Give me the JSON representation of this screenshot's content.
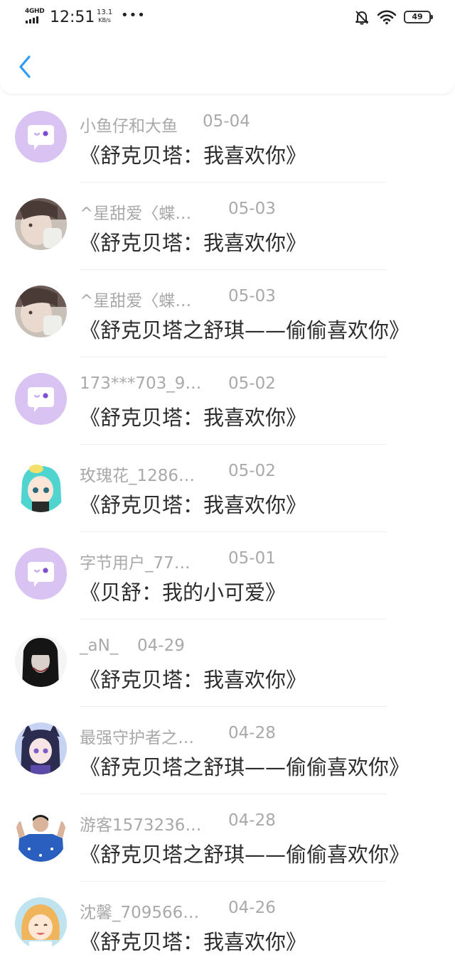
{
  "status_bar": {
    "network": "4GHD",
    "time": "12:51",
    "speed_value": "13.1",
    "speed_unit": "KB/s",
    "more": "•••",
    "battery": "49",
    "icons": [
      "signal-icon",
      "mute-bell-icon",
      "wifi-icon",
      "battery-icon"
    ]
  },
  "nav": {
    "back_icon": "chevron-left-icon",
    "accent_color": "#2f9cf4"
  },
  "comments": [
    {
      "name": "小鱼仔和大鱼",
      "date": "05-04",
      "text": "《舒克贝塔：我喜欢你》",
      "avatar": "default"
    },
    {
      "name": "^星甜爱〈蝶…",
      "date": "05-03",
      "text": "《舒克贝塔：我喜欢你》",
      "avatar": "photo-girl"
    },
    {
      "name": "^星甜爱〈蝶…",
      "date": "05-03",
      "text": "《舒克贝塔之舒琪——偷偷喜欢你》",
      "avatar": "photo-girl"
    },
    {
      "name": "173***703_9…",
      "date": "05-02",
      "text": "《舒克贝塔：我喜欢你》",
      "avatar": "default"
    },
    {
      "name": "玫瑰花_1286…",
      "date": "05-02",
      "text": "《舒克贝塔：我喜欢你》",
      "avatar": "anime-teal"
    },
    {
      "name": "字节用户_77…",
      "date": "05-01",
      "text": "《贝舒：我的小可爱》",
      "avatar": "default"
    },
    {
      "name": "_aN_",
      "date": "04-29",
      "text": "《舒克贝塔：我喜欢你》",
      "avatar": "photo-dark"
    },
    {
      "name": "最强守护者之…",
      "date": "04-28",
      "text": "《舒克贝塔之舒琪——偷偷喜欢你》",
      "avatar": "anime-purple"
    },
    {
      "name": "游客1573236…",
      "date": "04-28",
      "text": "《舒克贝塔之舒琪——偷偷喜欢你》",
      "avatar": "photo-blue"
    },
    {
      "name": "沈馨_709566…",
      "date": "04-26",
      "text": "《舒克贝塔：我喜欢你》",
      "avatar": "anime-smile"
    }
  ]
}
